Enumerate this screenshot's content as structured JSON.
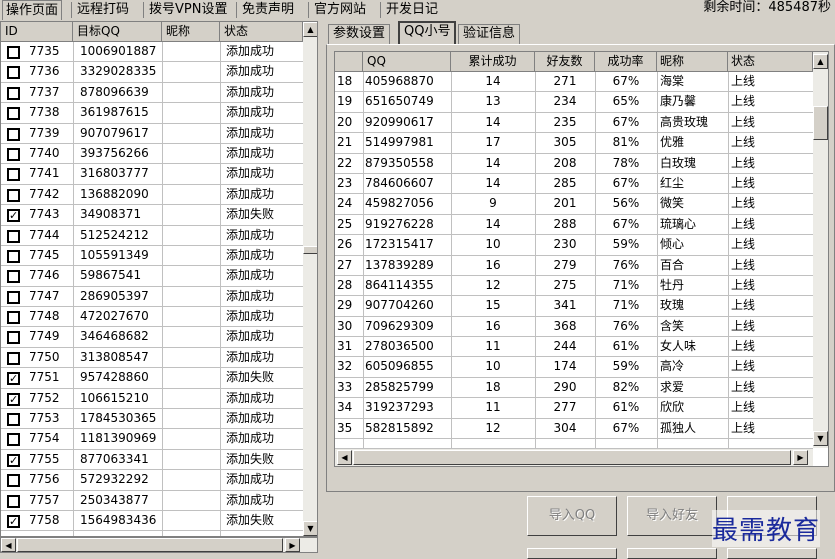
{
  "menu_tabs": [
    "操作页面",
    "远程打码",
    "拨号VPN设置",
    "免责声明",
    "官方网站",
    "开发日记"
  ],
  "timer": "剩余时间：485487秒",
  "left_grid": {
    "columns": [
      "ID",
      "目标QQ",
      "昵称",
      "状态"
    ],
    "rows": [
      {
        "checked": false,
        "id": "7735",
        "qq": "1006901887",
        "nick": "",
        "status": "添加成功"
      },
      {
        "checked": false,
        "id": "7736",
        "qq": "3329028335",
        "nick": "",
        "status": "添加成功"
      },
      {
        "checked": false,
        "id": "7737",
        "qq": "878096639",
        "nick": "",
        "status": "添加成功"
      },
      {
        "checked": false,
        "id": "7738",
        "qq": "361987615",
        "nick": "",
        "status": "添加成功"
      },
      {
        "checked": false,
        "id": "7739",
        "qq": "907079617",
        "nick": "",
        "status": "添加成功"
      },
      {
        "checked": false,
        "id": "7740",
        "qq": "393756266",
        "nick": "",
        "status": "添加成功"
      },
      {
        "checked": false,
        "id": "7741",
        "qq": "316803777",
        "nick": "",
        "status": "添加成功"
      },
      {
        "checked": false,
        "id": "7742",
        "qq": "136882090",
        "nick": "",
        "status": "添加成功"
      },
      {
        "checked": true,
        "id": "7743",
        "qq": "34908371",
        "nick": "",
        "status": "添加失败"
      },
      {
        "checked": false,
        "id": "7744",
        "qq": "512524212",
        "nick": "",
        "status": "添加成功"
      },
      {
        "checked": false,
        "id": "7745",
        "qq": "105591349",
        "nick": "",
        "status": "添加成功"
      },
      {
        "checked": false,
        "id": "7746",
        "qq": "59867541",
        "nick": "",
        "status": "添加成功"
      },
      {
        "checked": false,
        "id": "7747",
        "qq": "286905397",
        "nick": "",
        "status": "添加成功"
      },
      {
        "checked": false,
        "id": "7748",
        "qq": "472027670",
        "nick": "",
        "status": "添加成功"
      },
      {
        "checked": false,
        "id": "7749",
        "qq": "346468682",
        "nick": "",
        "status": "添加成功"
      },
      {
        "checked": false,
        "id": "7750",
        "qq": "313808547",
        "nick": "",
        "status": "添加成功"
      },
      {
        "checked": true,
        "id": "7751",
        "qq": "957428860",
        "nick": "",
        "status": "添加失败"
      },
      {
        "checked": true,
        "id": "7752",
        "qq": "106615210",
        "nick": "",
        "status": "添加成功"
      },
      {
        "checked": false,
        "id": "7753",
        "qq": "1784530365",
        "nick": "",
        "status": "添加成功"
      },
      {
        "checked": false,
        "id": "7754",
        "qq": "1181390969",
        "nick": "",
        "status": "添加成功"
      },
      {
        "checked": true,
        "id": "7755",
        "qq": "877063341",
        "nick": "",
        "status": "添加失败"
      },
      {
        "checked": false,
        "id": "7756",
        "qq": "572932292",
        "nick": "",
        "status": "添加成功"
      },
      {
        "checked": false,
        "id": "7757",
        "qq": "250343877",
        "nick": "",
        "status": "添加成功"
      },
      {
        "checked": true,
        "id": "7758",
        "qq": "1564983436",
        "nick": "",
        "status": "添加失败"
      }
    ]
  },
  "right_tabs": [
    "参数设置",
    "QQ小号",
    "验证信息"
  ],
  "right_grid": {
    "columns": [
      "",
      "QQ",
      "累计成功",
      "好友数",
      "成功率",
      "昵称",
      "状态"
    ],
    "rows": [
      {
        "n": "18",
        "qq": "405968870",
        "acc": "14",
        "friends": "271",
        "rate": "67%",
        "nick": "海棠",
        "status": "上线"
      },
      {
        "n": "19",
        "qq": "651650749",
        "acc": "13",
        "friends": "234",
        "rate": "65%",
        "nick": "康乃馨",
        "status": "上线"
      },
      {
        "n": "20",
        "qq": "920990617",
        "acc": "14",
        "friends": "235",
        "rate": "67%",
        "nick": "高贵玫瑰",
        "status": "上线"
      },
      {
        "n": "21",
        "qq": "514997981",
        "acc": "17",
        "friends": "305",
        "rate": "81%",
        "nick": "优雅",
        "status": "上线"
      },
      {
        "n": "22",
        "qq": "879350558",
        "acc": "14",
        "friends": "208",
        "rate": "78%",
        "nick": "白玫瑰",
        "status": "上线"
      },
      {
        "n": "23",
        "qq": "784606607",
        "acc": "14",
        "friends": "285",
        "rate": "67%",
        "nick": "红尘",
        "status": "上线"
      },
      {
        "n": "24",
        "qq": "459827056",
        "acc": "9",
        "friends": "201",
        "rate": "56%",
        "nick": "微笑",
        "status": "上线"
      },
      {
        "n": "25",
        "qq": "919276228",
        "acc": "14",
        "friends": "288",
        "rate": "67%",
        "nick": "琉璃心",
        "status": "上线"
      },
      {
        "n": "26",
        "qq": "172315417",
        "acc": "10",
        "friends": "230",
        "rate": "59%",
        "nick": "倾心",
        "status": "上线"
      },
      {
        "n": "27",
        "qq": "137839289",
        "acc": "16",
        "friends": "279",
        "rate": "76%",
        "nick": "百合",
        "status": "上线"
      },
      {
        "n": "28",
        "qq": "864114355",
        "acc": "12",
        "friends": "275",
        "rate": "71%",
        "nick": "牡丹",
        "status": "上线"
      },
      {
        "n": "29",
        "qq": "907704260",
        "acc": "15",
        "friends": "341",
        "rate": "71%",
        "nick": "玫瑰",
        "status": "上线"
      },
      {
        "n": "30",
        "qq": "709629309",
        "acc": "16",
        "friends": "368",
        "rate": "76%",
        "nick": "含笑",
        "status": "上线"
      },
      {
        "n": "31",
        "qq": "278036500",
        "acc": "11",
        "friends": "244",
        "rate": "61%",
        "nick": "女人味",
        "status": "上线"
      },
      {
        "n": "32",
        "qq": "605096855",
        "acc": "10",
        "friends": "174",
        "rate": "59%",
        "nick": "高冷",
        "status": "上线"
      },
      {
        "n": "33",
        "qq": "285825799",
        "acc": "18",
        "friends": "290",
        "rate": "82%",
        "nick": "求爱",
        "status": "上线"
      },
      {
        "n": "34",
        "qq": "319237293",
        "acc": "11",
        "friends": "277",
        "rate": "61%",
        "nick": "欣欣",
        "status": "上线"
      },
      {
        "n": "35",
        "qq": "582815892",
        "acc": "12",
        "friends": "304",
        "rate": "67%",
        "nick": "孤独人",
        "status": "上线"
      }
    ]
  },
  "buttons": {
    "import_qq": "导入QQ",
    "import_friends": "导入好友"
  },
  "watermark": "最需教育",
  "icons": {
    "up": "arrow-up-icon",
    "down": "arrow-down-icon",
    "left": "arrow-left-icon",
    "right": "arrow-right-icon"
  }
}
